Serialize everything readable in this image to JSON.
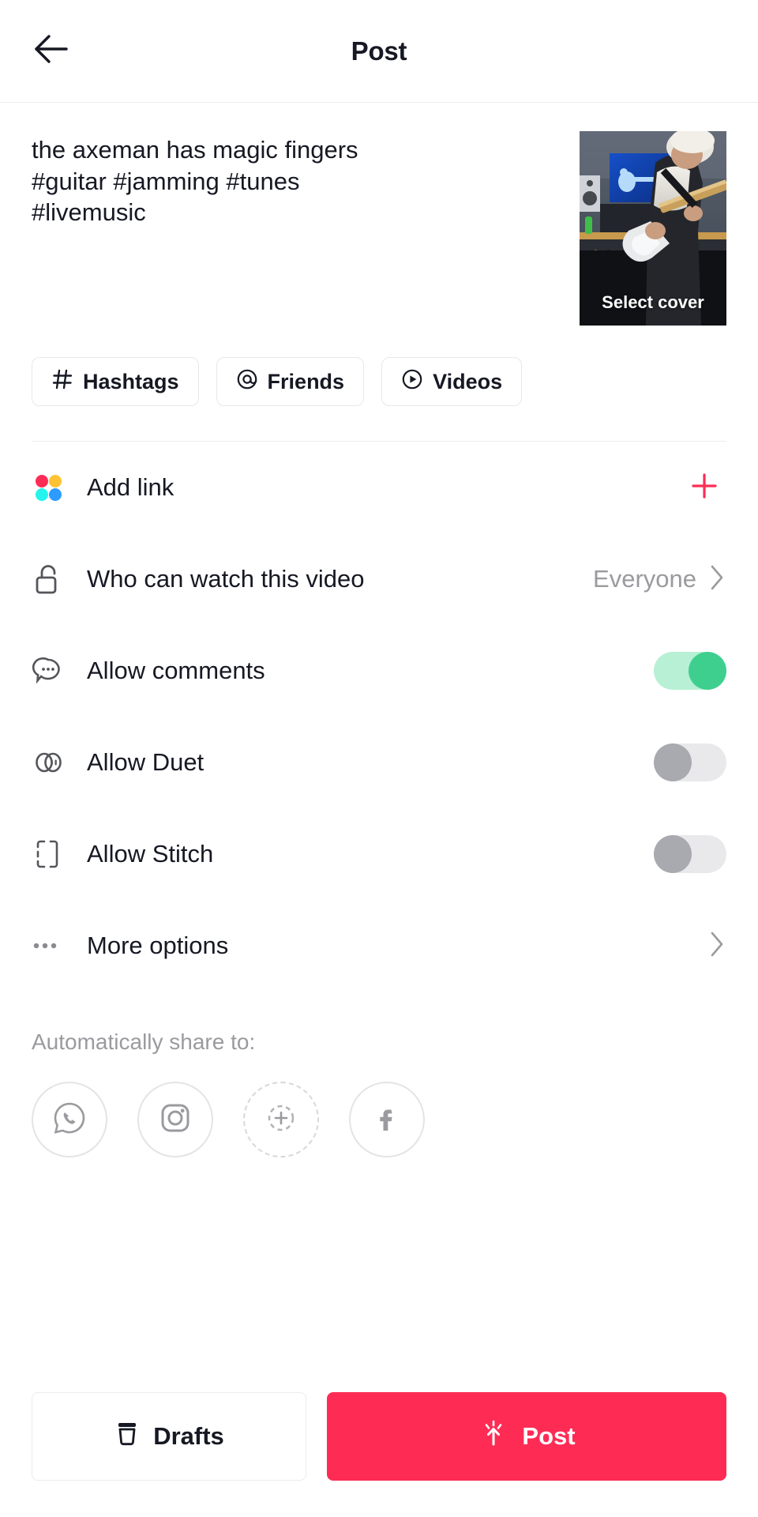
{
  "header": {
    "title": "Post",
    "back_icon": "arrow-left-icon"
  },
  "caption": {
    "lines": [
      "the axeman has magic fingers",
      "#guitar #jamming #tunes",
      "#livemusic"
    ],
    "full_text": "the axeman has magic fingers #guitar #jamming #tunes #livemusic"
  },
  "cover": {
    "label": "Select cover",
    "description": "guitarist playing white electric guitar in a studio with blue screen behind"
  },
  "chips": [
    {
      "label": "Hashtags",
      "icon": "hashtag-icon"
    },
    {
      "label": "Friends",
      "icon": "at-mention-icon"
    },
    {
      "label": "Videos",
      "icon": "play-circle-icon"
    }
  ],
  "settings": {
    "add_link": {
      "label": "Add link",
      "icon": "four-dots-icon",
      "action_icon": "plus-icon",
      "accent": "#FE2C55"
    },
    "privacy": {
      "label": "Who can watch this video",
      "value": "Everyone",
      "icon": "unlock-icon",
      "chevron": "chevron-right-icon"
    },
    "toggles": [
      {
        "label": "Allow comments",
        "icon": "comment-bubble-icon",
        "state": "on"
      },
      {
        "label": "Allow Duet",
        "icon": "duet-icon",
        "state": "off"
      },
      {
        "label": "Allow Stitch",
        "icon": "stitch-icon",
        "state": "off"
      }
    ],
    "more_options": {
      "label": "More options",
      "icon": "ellipsis-icon",
      "chevron": "chevron-right-icon"
    }
  },
  "share": {
    "title": "Automatically share to:",
    "targets": [
      {
        "name": "whatsapp-icon"
      },
      {
        "name": "instagram-icon"
      },
      {
        "name": "add-more-icon"
      },
      {
        "name": "facebook-icon"
      }
    ]
  },
  "bottom": {
    "drafts": {
      "label": "Drafts",
      "icon": "drafts-box-icon"
    },
    "post": {
      "label": "Post",
      "icon": "upload-sparkle-icon",
      "color": "#FE2C55"
    }
  },
  "colors": {
    "accent_red": "#FE2C55",
    "toggle_on": "#3ECF8E",
    "toggle_on_track": "#B7F0D4",
    "toggle_off": "#A9A9B0",
    "text": "#161823",
    "muted": "#9A9A9F",
    "border": "#ECECEC"
  }
}
